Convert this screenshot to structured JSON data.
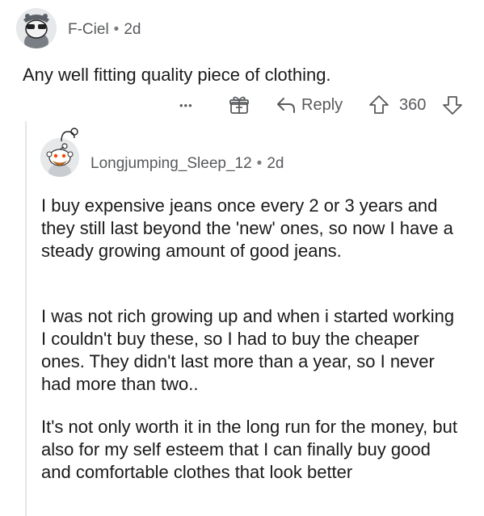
{
  "parent_comment": {
    "username": "F-Ciel",
    "separator": "•",
    "age": "2d",
    "text": "Any well fitting quality piece of clothing.",
    "actions": {
      "more_label": "•••",
      "reply_label": "Reply",
      "score": "360"
    }
  },
  "reply_comment": {
    "username": "Longjumping_Sleep_12",
    "separator": "•",
    "age": "2d",
    "paragraphs": [
      "I buy expensive jeans once every 2 or 3 years and they still last beyond the 'new' ones, so now I have a steady growing amount of good jeans.",
      "I was not rich growing up and when i started working I couldn't buy these, so I had to buy the cheaper ones. They didn't last more than a year, so I never had more than two..",
      "It's not only worth it in the long run for the money, but also for my self esteem that I can finally buy good and comfortable clothes that look better"
    ]
  },
  "icons": {
    "more": "more-options-icon",
    "award": "award-icon",
    "reply": "reply-arrow-icon",
    "upvote": "upvote-icon",
    "downvote": "downvote-icon"
  }
}
